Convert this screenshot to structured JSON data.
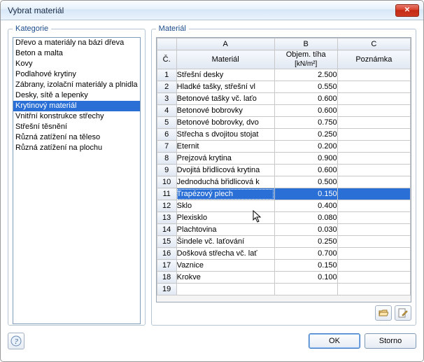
{
  "window": {
    "title": "Vybrat materiál",
    "close_symbol": "✕"
  },
  "categories": {
    "legend": "Kategorie",
    "items": [
      "Dřevo a materiály na bázi dřeva",
      "Beton a malta",
      "Kovy",
      "Podlahové krytiny",
      "Zábrany, izolační materiály a plnidla",
      "Desky, sítě a lepenky",
      "Krytinový materiál",
      "Vnitřní konstrukce střechy",
      "Střešní těsnění",
      "Různá zatížení na těleso",
      "Různá zatížení na plochu"
    ],
    "selected_index": 6
  },
  "materials": {
    "legend": "Materiál",
    "letters": [
      "A",
      "B",
      "C"
    ],
    "rownum_header": "Č.",
    "headers": {
      "a": "Materiál",
      "b_line1": "Objem. tíha",
      "b_line2": "[kN/m²]",
      "c": "Poznámka"
    },
    "rows": [
      {
        "n": 1,
        "a": "Střešní desky",
        "b": "2.500",
        "c": ""
      },
      {
        "n": 2,
        "a": "Hladké tašky, střešní vl",
        "b": "0.550",
        "c": ""
      },
      {
        "n": 3,
        "a": "Betonové tašky vč. laťo",
        "b": "0.600",
        "c": ""
      },
      {
        "n": 4,
        "a": "Betonové bobrovky",
        "b": "0.600",
        "c": ""
      },
      {
        "n": 5,
        "a": "Betonové bobrovky, dvo",
        "b": "0.750",
        "c": ""
      },
      {
        "n": 6,
        "a": "Střecha s dvojitou stojat",
        "b": "0.250",
        "c": ""
      },
      {
        "n": 7,
        "a": "Eternit",
        "b": "0.200",
        "c": ""
      },
      {
        "n": 8,
        "a": "Prejzová krytina",
        "b": "0.900",
        "c": ""
      },
      {
        "n": 9,
        "a": "Dvojitá břidlicová krytina",
        "b": "0.600",
        "c": ""
      },
      {
        "n": 10,
        "a": "Jednoduchá břidlicová k",
        "b": "0.500",
        "c": ""
      },
      {
        "n": 11,
        "a": "Trapézový plech",
        "b": "0.150",
        "c": ""
      },
      {
        "n": 12,
        "a": "Sklo",
        "b": "0.400",
        "c": ""
      },
      {
        "n": 13,
        "a": "Plexisklo",
        "b": "0.080",
        "c": ""
      },
      {
        "n": 14,
        "a": "Plachtovina",
        "b": "0.030",
        "c": ""
      },
      {
        "n": 15,
        "a": "Šindele vč. laťování",
        "b": "0.250",
        "c": ""
      },
      {
        "n": 16,
        "a": "Došková střecha vč. lať",
        "b": "0.700",
        "c": ""
      },
      {
        "n": 17,
        "a": "Vaznice",
        "b": "0.150",
        "c": ""
      },
      {
        "n": 18,
        "a": "Krokve",
        "b": "0.100",
        "c": ""
      },
      {
        "n": 19,
        "a": "",
        "b": "",
        "c": ""
      }
    ],
    "selected_row": 11
  },
  "footer": {
    "ok": "OK",
    "cancel": "Storno"
  }
}
